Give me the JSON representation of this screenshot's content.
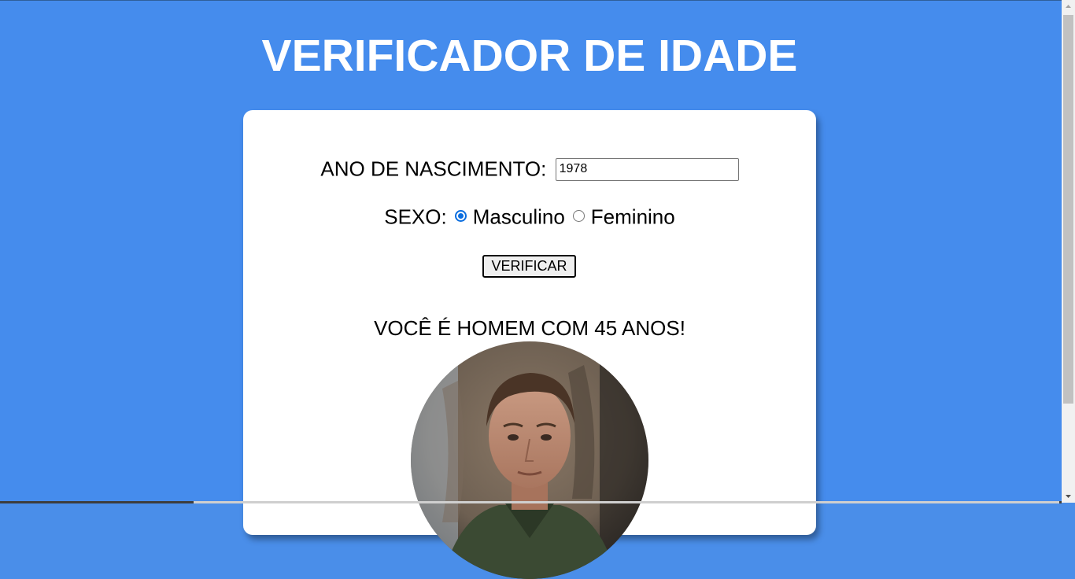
{
  "page": {
    "title": "VERIFICADOR DE IDADE"
  },
  "form": {
    "birth_year_label": "ANO DE NASCIMENTO:",
    "birth_year_value": "1978",
    "sex_label": "SEXO:",
    "sex_options": [
      {
        "label": "Masculino",
        "checked": true
      },
      {
        "label": "Feminino",
        "checked": false
      }
    ],
    "verify_button_label": "VERIFICAR"
  },
  "result": {
    "message": "VOCÊ É HOMEM COM 45 ANOS!",
    "photo": "man-portrait-photo"
  },
  "colors": {
    "background": "#458ced",
    "card": "#ffffff",
    "radio_accent": "#0a6ddf"
  }
}
